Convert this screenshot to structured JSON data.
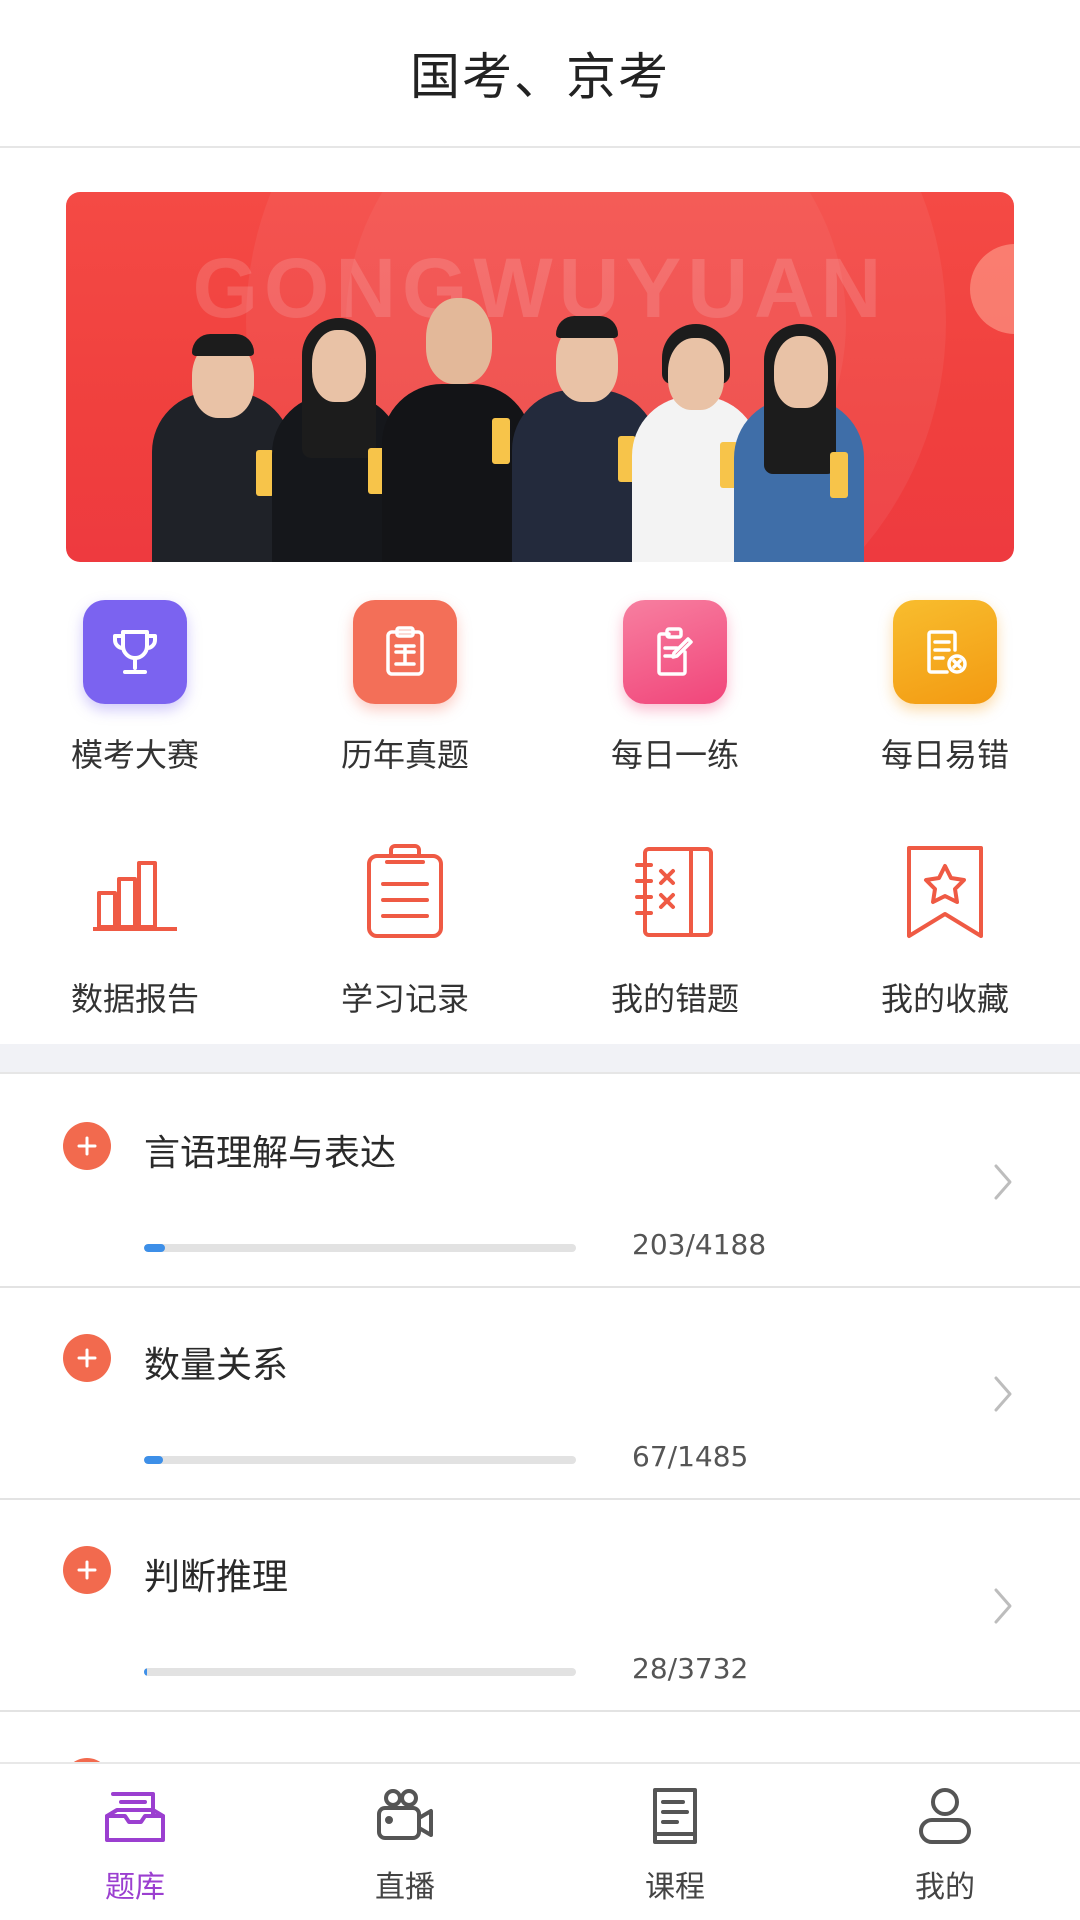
{
  "header": {
    "title": "国考、京考"
  },
  "banner": {
    "watermark": "GONGWUYUAN"
  },
  "grid_row1": [
    {
      "label": "模考大赛",
      "icon": "trophy-icon",
      "color": "#7b63f0"
    },
    {
      "label": "历年真题",
      "icon": "clipboard-real-icon",
      "color": "#f36f58"
    },
    {
      "label": "每日一练",
      "icon": "clipboard-edit-icon",
      "color": "#f4607e"
    },
    {
      "label": "每日易错",
      "icon": "document-error-icon",
      "color": "#f6a21d"
    }
  ],
  "grid_row2": [
    {
      "label": "数据报告",
      "icon": "bar-chart-icon"
    },
    {
      "label": "学习记录",
      "icon": "clipboard-list-icon"
    },
    {
      "label": "我的错题",
      "icon": "error-book-icon"
    },
    {
      "label": "我的收藏",
      "icon": "bookmark-star-icon"
    }
  ],
  "categories": [
    {
      "name": "言语理解与表达",
      "count": "203/4188",
      "progress": 0.048
    },
    {
      "name": "数量关系",
      "count": "67/1485",
      "progress": 0.045
    },
    {
      "name": "判断推理",
      "count": "28/3732",
      "progress": 0.0075
    }
  ],
  "tabs": [
    {
      "label": "题库",
      "icon": "question-bank-icon",
      "active": true
    },
    {
      "label": "直播",
      "icon": "camera-icon",
      "active": false
    },
    {
      "label": "课程",
      "icon": "book-icon",
      "active": false
    },
    {
      "label": "我的",
      "icon": "user-icon",
      "active": false
    }
  ],
  "colors": {
    "accent": "#9b3fd0",
    "plus": "#f26a4e",
    "progress": "#3d8fe8",
    "line_icon": "#ef5a44"
  }
}
